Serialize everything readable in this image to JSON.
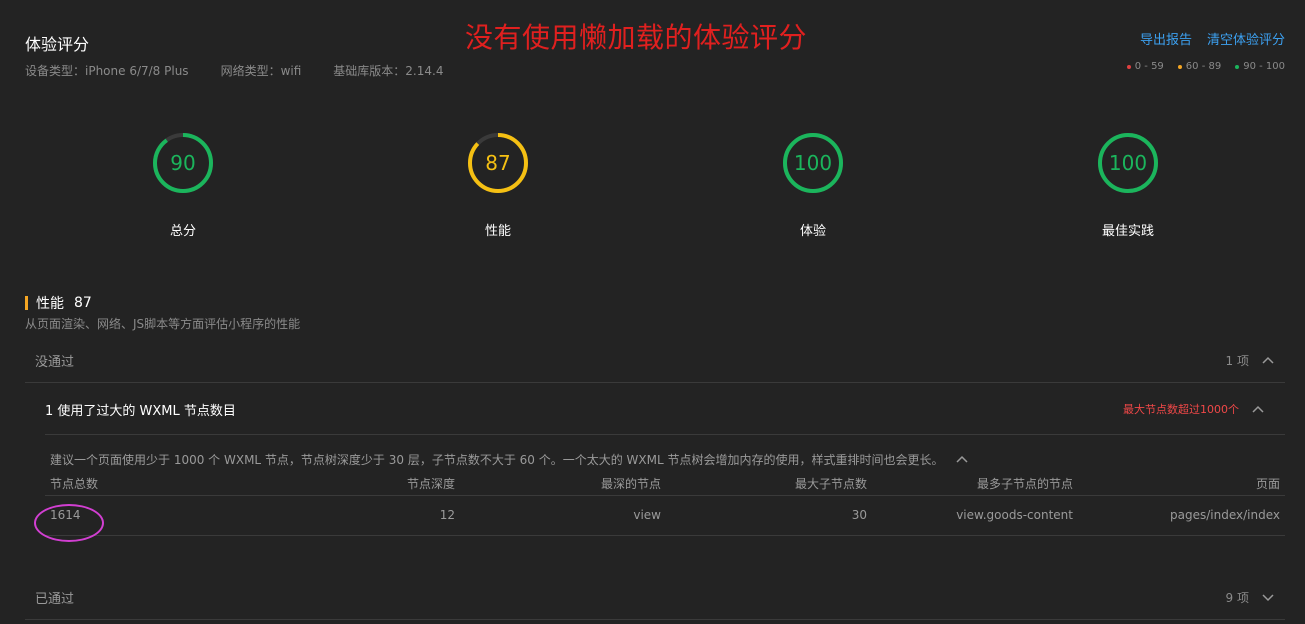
{
  "header": {
    "title": "体验评分",
    "overlay_title": "没有使用懒加载的体验评分",
    "device_label": "设备类型：iPhone 6/7/8 Plus",
    "network_label": "网络类型：wifi",
    "lib_label": "基础库版本：2.14.4",
    "export_label": "导出报告",
    "clear_label": "清空体验评分"
  },
  "legend": [
    {
      "label": "0 - 59",
      "color": "#e04040"
    },
    {
      "label": "60 - 89",
      "color": "#f5a623"
    },
    {
      "label": "90 - 100",
      "color": "#1bb55c"
    }
  ],
  "scores": [
    {
      "value": "90",
      "label": "总分",
      "color": "#1bb55c",
      "fraction": 0.9
    },
    {
      "value": "87",
      "label": "性能",
      "color": "#f5c013",
      "fraction": 0.87
    },
    {
      "value": "100",
      "label": "体验",
      "color": "#1bb55c",
      "fraction": 1.0
    },
    {
      "value": "100",
      "label": "最佳实践",
      "color": "#1bb55c",
      "fraction": 1.0
    }
  ],
  "section": {
    "name": "性能",
    "score": "87",
    "desc": "从页面渲染、网络、JS脚本等方面评估小程序的性能"
  },
  "failed": {
    "label": "没通过",
    "count": "1 项"
  },
  "audit": {
    "title": "1 使用了过大的 WXML 节点数目",
    "warning": "最大节点数超过1000个",
    "advice": "建议一个页面使用少于 1000 个 WXML 节点，节点树深度少于 30 层，子节点数不大于 60 个。一个太大的 WXML 节点树会增加内存的使用，样式重排时间也会更长。",
    "columns": [
      "节点总数",
      "节点深度",
      "最深的节点",
      "最大子节点数",
      "最多子节点的节点",
      "页面"
    ],
    "row": [
      "1614",
      "12",
      "view",
      "30",
      "view.goods-content",
      "pages/index/index"
    ]
  },
  "passed": {
    "label": "已通过",
    "count": "9 项"
  }
}
